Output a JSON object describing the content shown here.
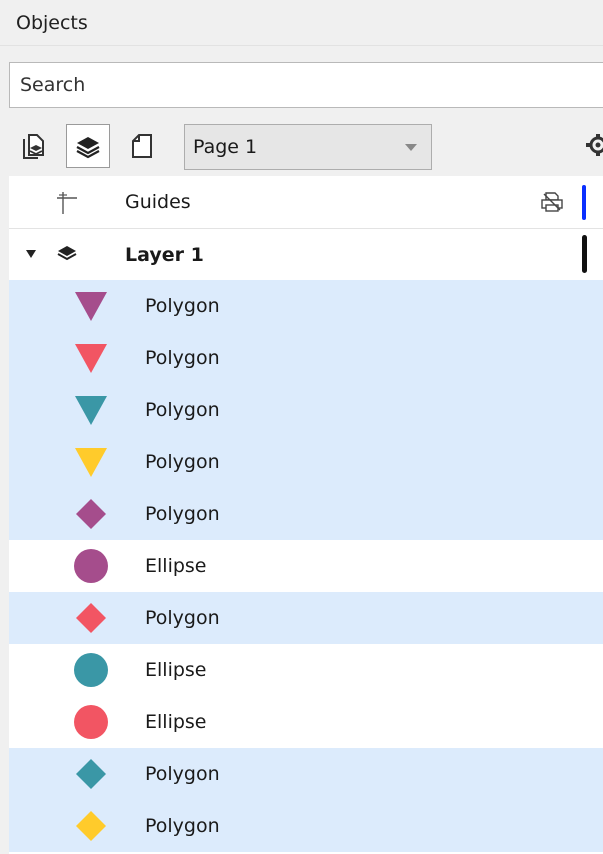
{
  "panel": {
    "title": "Objects"
  },
  "search": {
    "placeholder": "Search",
    "value": ""
  },
  "toolbar": {
    "page_select_value": "Page 1",
    "buttons": [
      "layer-manager",
      "layers-view",
      "page-view"
    ],
    "active_button": "layers-view"
  },
  "tree": {
    "guides": {
      "label": "Guides",
      "marker_color": "#0a2fff"
    },
    "layer": {
      "label": "Layer 1",
      "expanded": true,
      "marker_color": "#111111"
    },
    "objects": [
      {
        "label": "Polygon",
        "shape": "triangle-down",
        "color": "#a54d8c",
        "selected": true
      },
      {
        "label": "Polygon",
        "shape": "triangle-down",
        "color": "#f25563",
        "selected": true
      },
      {
        "label": "Polygon",
        "shape": "triangle-down",
        "color": "#3a97a6",
        "selected": true
      },
      {
        "label": "Polygon",
        "shape": "triangle-down",
        "color": "#ffcb2b",
        "selected": true
      },
      {
        "label": "Polygon",
        "shape": "diamond",
        "color": "#a54d8c",
        "selected": true
      },
      {
        "label": "Ellipse",
        "shape": "circle",
        "color": "#a54d8c",
        "selected": false
      },
      {
        "label": "Polygon",
        "shape": "diamond",
        "color": "#f25563",
        "selected": true
      },
      {
        "label": "Ellipse",
        "shape": "circle",
        "color": "#3a97a6",
        "selected": false
      },
      {
        "label": "Ellipse",
        "shape": "circle",
        "color": "#f25563",
        "selected": false
      },
      {
        "label": "Polygon",
        "shape": "diamond",
        "color": "#3a97a6",
        "selected": true
      },
      {
        "label": "Polygon",
        "shape": "diamond",
        "color": "#ffcb2b",
        "selected": true
      }
    ]
  },
  "colors": {
    "selection": "#dcebfc",
    "panel_bg": "#f0f0f0"
  }
}
